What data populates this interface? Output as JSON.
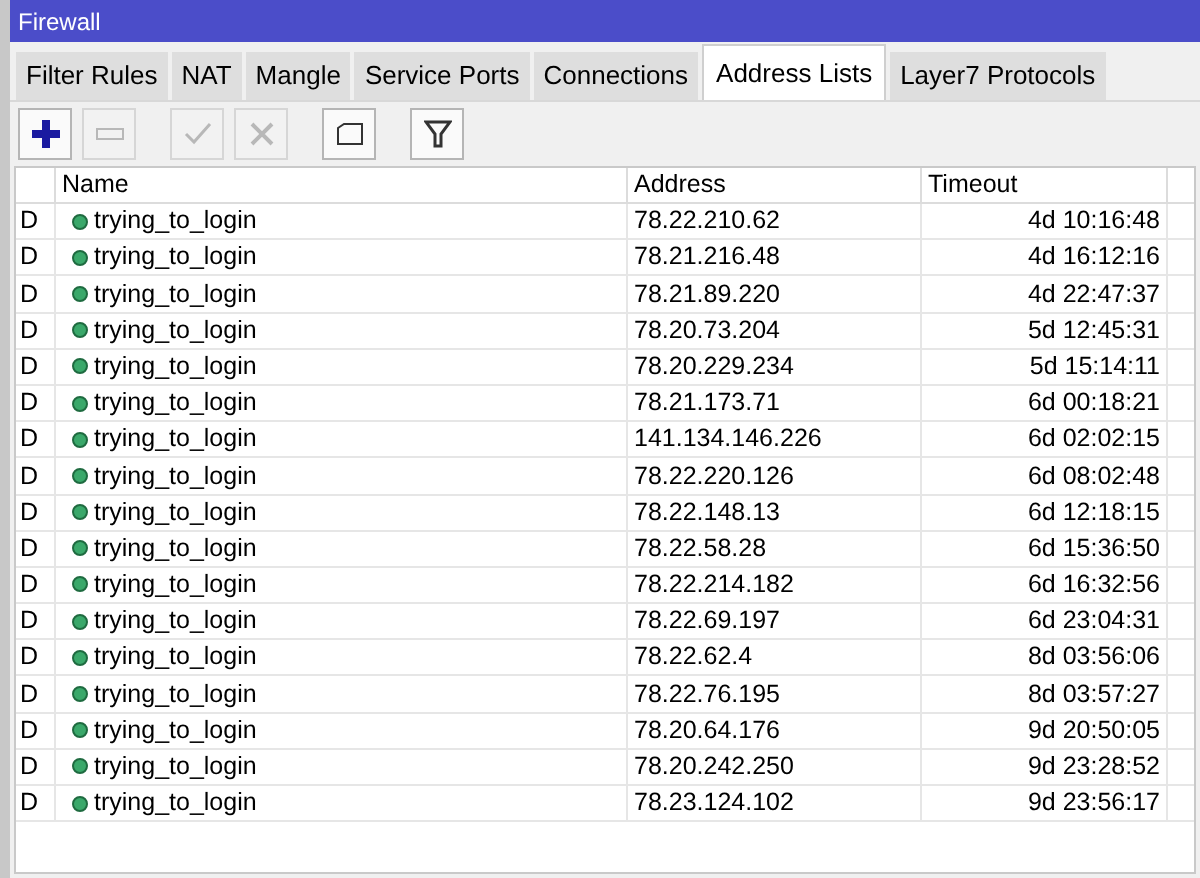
{
  "window": {
    "title": "Firewall"
  },
  "tabs": [
    {
      "label": "Filter Rules",
      "selected": false
    },
    {
      "label": "NAT",
      "selected": false
    },
    {
      "label": "Mangle",
      "selected": false
    },
    {
      "label": "Service Ports",
      "selected": false
    },
    {
      "label": "Connections",
      "selected": false
    },
    {
      "label": "Address Lists",
      "selected": true
    },
    {
      "label": "Layer7 Protocols",
      "selected": false
    }
  ],
  "toolbar": [
    {
      "kind": "add",
      "disabled": false
    },
    {
      "kind": "remove",
      "disabled": true
    },
    {
      "kind": "enable",
      "disabled": true
    },
    {
      "kind": "disable",
      "disabled": true
    },
    {
      "kind": "comment",
      "disabled": false
    },
    {
      "kind": "filter",
      "disabled": false
    }
  ],
  "table": {
    "columns": [
      "Name",
      "Address",
      "Timeout"
    ],
    "rows": [
      {
        "flag": "D",
        "name": "trying_to_login",
        "address": "78.22.210.62",
        "timeout": "4d 10:16:48"
      },
      {
        "flag": "D",
        "name": "trying_to_login",
        "address": "78.21.216.48",
        "timeout": "4d 16:12:16"
      },
      {
        "flag": "D",
        "name": "trying_to_login",
        "address": "78.21.89.220",
        "timeout": "4d 22:47:37"
      },
      {
        "flag": "D",
        "name": "trying_to_login",
        "address": "78.20.73.204",
        "timeout": "5d 12:45:31"
      },
      {
        "flag": "D",
        "name": "trying_to_login",
        "address": "78.20.229.234",
        "timeout": "5d 15:14:11"
      },
      {
        "flag": "D",
        "name": "trying_to_login",
        "address": "78.21.173.71",
        "timeout": "6d 00:18:21"
      },
      {
        "flag": "D",
        "name": "trying_to_login",
        "address": "141.134.146.226",
        "timeout": "6d 02:02:15"
      },
      {
        "flag": "D",
        "name": "trying_to_login",
        "address": "78.22.220.126",
        "timeout": "6d 08:02:48"
      },
      {
        "flag": "D",
        "name": "trying_to_login",
        "address": "78.22.148.13",
        "timeout": "6d 12:18:15"
      },
      {
        "flag": "D",
        "name": "trying_to_login",
        "address": "78.22.58.28",
        "timeout": "6d 15:36:50"
      },
      {
        "flag": "D",
        "name": "trying_to_login",
        "address": "78.22.214.182",
        "timeout": "6d 16:32:56"
      },
      {
        "flag": "D",
        "name": "trying_to_login",
        "address": "78.22.69.197",
        "timeout": "6d 23:04:31"
      },
      {
        "flag": "D",
        "name": "trying_to_login",
        "address": "78.22.62.4",
        "timeout": "8d 03:56:06"
      },
      {
        "flag": "D",
        "name": "trying_to_login",
        "address": "78.22.76.195",
        "timeout": "8d 03:57:27"
      },
      {
        "flag": "D",
        "name": "trying_to_login",
        "address": "78.20.64.176",
        "timeout": "9d 20:50:05"
      },
      {
        "flag": "D",
        "name": "trying_to_login",
        "address": "78.20.242.250",
        "timeout": "9d 23:28:52"
      },
      {
        "flag": "D",
        "name": "trying_to_login",
        "address": "78.23.124.102",
        "timeout": "9d 23:56:17"
      }
    ]
  }
}
